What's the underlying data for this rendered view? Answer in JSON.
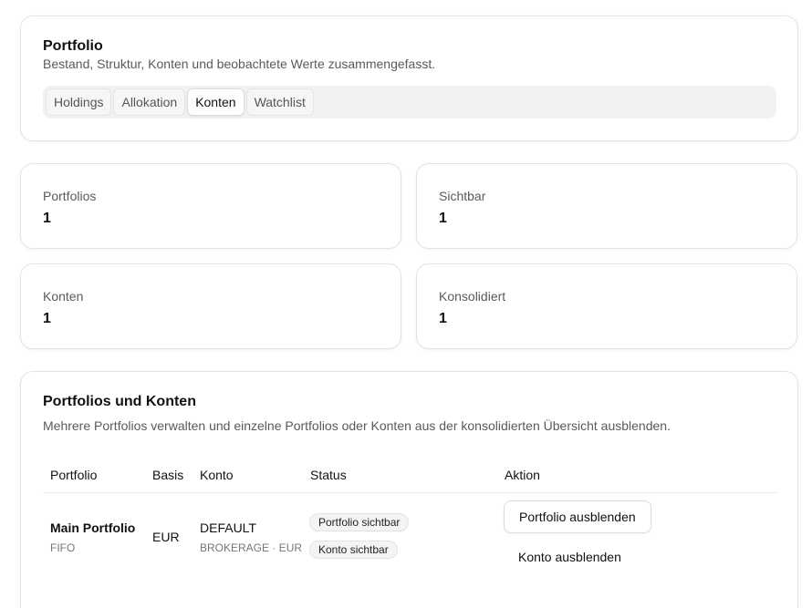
{
  "header": {
    "title": "Portfolio",
    "subtitle": "Bestand, Struktur, Konten und beobachtete Werte zusammengefasst.",
    "tabs": [
      {
        "label": "Holdings",
        "active": false
      },
      {
        "label": "Allokation",
        "active": false
      },
      {
        "label": "Konten",
        "active": true
      },
      {
        "label": "Watchlist",
        "active": false
      }
    ]
  },
  "stats": [
    {
      "label": "Portfolios",
      "value": "1"
    },
    {
      "label": "Sichtbar",
      "value": "1"
    },
    {
      "label": "Konten",
      "value": "1"
    },
    {
      "label": "Konsolidiert",
      "value": "1"
    }
  ],
  "accounts": {
    "title": "Portfolios und Konten",
    "subtitle": "Mehrere Portfolios verwalten und einzelne Portfolios oder Konten aus der konsolidierten Übersicht ausblenden.",
    "columns": [
      "Portfolio",
      "Basis",
      "Konto",
      "Status",
      "Aktion"
    ],
    "rows": [
      {
        "portfolio_name": "Main Portfolio",
        "portfolio_method": "FIFO",
        "basis": "EUR",
        "account_name": "DEFAULT",
        "account_detail": "BROKERAGE · EUR",
        "status_portfolio": "Portfolio sichtbar",
        "status_account": "Konto sichtbar",
        "action_portfolio": "Portfolio ausblenden",
        "action_account": "Konto ausblenden"
      }
    ]
  }
}
